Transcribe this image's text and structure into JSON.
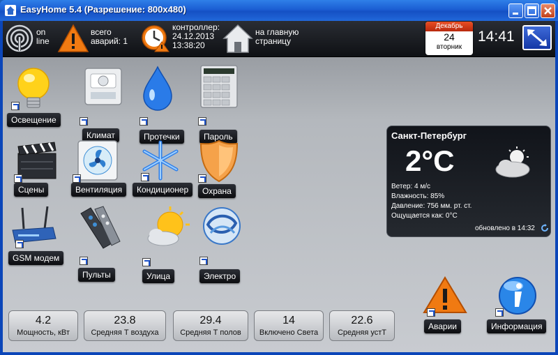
{
  "window": {
    "title": "EasyHome 5.4 (Разрешение: 800x480)"
  },
  "topbar": {
    "status_line1": "on",
    "status_line2": "line",
    "alarms_line1": "всего",
    "alarms_line2": "аварий: 1",
    "controller_label": "контроллер:",
    "controller_date": "24.12.2013",
    "controller_time": "13:38:20",
    "home_line1": "на главную",
    "home_line2": "страницу",
    "calendar_month": "Декабрь",
    "calendar_day": "24",
    "calendar_weekday": "вторник",
    "clock": "14:41"
  },
  "tiles": [
    {
      "label": "Освещение"
    },
    {
      "label": "Климат"
    },
    {
      "label": "Протечки"
    },
    {
      "label": "Пароль"
    },
    {
      "label": "Сцены"
    },
    {
      "label": "Вентиляция"
    },
    {
      "label": "Кондиционер"
    },
    {
      "label": "Охрана"
    },
    {
      "label": "GSM модем"
    },
    {
      "label": "Пульты"
    },
    {
      "label": "Улица"
    },
    {
      "label": "Электро"
    },
    {
      "label": "Аварии"
    },
    {
      "label": "Информация"
    }
  ],
  "weather": {
    "city": "Санкт-Петербург",
    "temperature": "2°C",
    "wind": "Ветер: 4 м/с",
    "humidity": "Влажность: 85%",
    "pressure": "Давление: 756 мм. рт. ст.",
    "feels_like": "Ощущается как: 0°C",
    "updated": "обновлено в 14:32"
  },
  "stats": [
    {
      "value": "4.2",
      "label": "Мощность, кВт"
    },
    {
      "value": "23.8",
      "label": "Средняя Т воздуха"
    },
    {
      "value": "29.4",
      "label": "Средняя Т полов"
    },
    {
      "value": "14",
      "label": "Включено Света"
    },
    {
      "value": "22.6",
      "label": "Средняя устТ"
    }
  ],
  "colors": {
    "accent": "#1d5fb8",
    "alert": "#f07a12",
    "panel": "#15181d"
  }
}
